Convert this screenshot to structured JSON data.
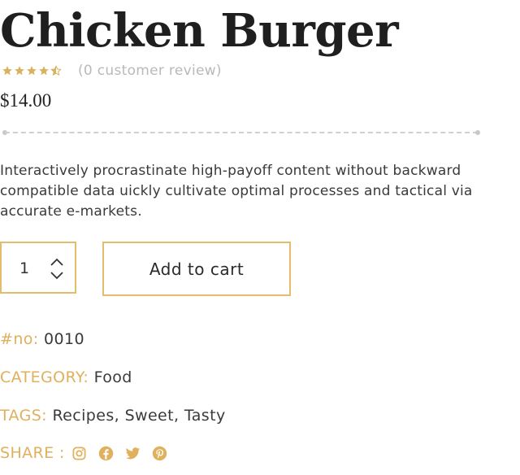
{
  "product": {
    "title": "Chicken Burger",
    "rating_stars": 4.5,
    "review_text": "(0 customer review)",
    "price": "$14.00",
    "description": "Interactively procrastinate high-payoff content without backward compatible data uickly cultivate optimal processes and tactical via accurate e-markets."
  },
  "cart": {
    "quantity": "1",
    "add_to_cart_label": "Add to cart"
  },
  "meta": {
    "sku_label": "#no:",
    "sku_value": "0010",
    "category_label": "CATEGORY:",
    "category_value": "Food",
    "tags_label": "TAGS:",
    "tags": [
      "Recipes",
      "Sweet",
      "Tasty"
    ],
    "share_label": "SHARE :",
    "share_icons": [
      "instagram-icon",
      "facebook-icon",
      "twitter-icon",
      "pinterest-icon"
    ]
  },
  "colors": {
    "accent": "#e3bd6d",
    "label": "#e0b05c",
    "star": "#d9b25f",
    "muted": "#b9b9b9"
  }
}
